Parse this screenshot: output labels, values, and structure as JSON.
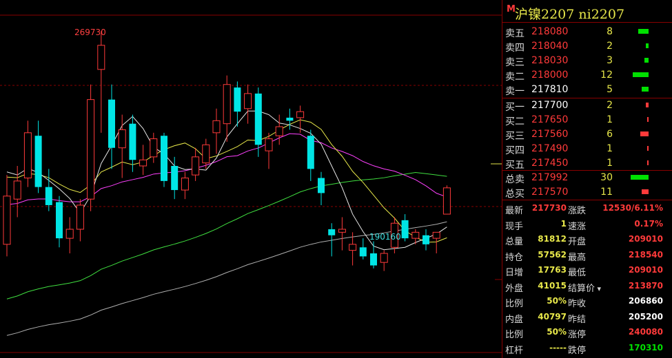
{
  "colors": {
    "up": "#ff3a3a",
    "down": "#00e5e5",
    "ma5": "#e8e8e8",
    "ma10": "#e8e84a",
    "ma20": "#ff40ff",
    "ma40": "#40e040",
    "ma60": "#b0b0b0",
    "yellow": "#e8e84a",
    "green": "#00e000",
    "white": "#ffffff"
  },
  "header": {
    "marker": "M",
    "title": "沪镍2207  ni2207"
  },
  "chart_data": {
    "type": "candlestick",
    "high_label": "269730",
    "low_label": "190160",
    "candles": [
      {
        "o": 199000,
        "h": 222000,
        "l": 195000,
        "c": 215000
      },
      {
        "o": 214000,
        "h": 225000,
        "l": 208000,
        "c": 220000
      },
      {
        "o": 221000,
        "h": 240000,
        "l": 218000,
        "c": 236000
      },
      {
        "o": 235000,
        "h": 240000,
        "l": 216000,
        "c": 218000
      },
      {
        "o": 218000,
        "h": 224000,
        "l": 210000,
        "c": 212000
      },
      {
        "o": 213000,
        "h": 215000,
        "l": 198000,
        "c": 201000
      },
      {
        "o": 201000,
        "h": 208000,
        "l": 196000,
        "c": 204000
      },
      {
        "o": 204000,
        "h": 214000,
        "l": 200000,
        "c": 212000
      },
      {
        "o": 214000,
        "h": 252000,
        "l": 210000,
        "c": 247000
      },
      {
        "o": 257000,
        "h": 269730,
        "l": 236000,
        "c": 265000
      },
      {
        "o": 247000,
        "h": 252000,
        "l": 224000,
        "c": 231000
      },
      {
        "o": 231000,
        "h": 242000,
        "l": 221000,
        "c": 237000
      },
      {
        "o": 239000,
        "h": 242000,
        "l": 223000,
        "c": 227000
      },
      {
        "o": 225000,
        "h": 232000,
        "l": 222000,
        "c": 227000
      },
      {
        "o": 228000,
        "h": 236000,
        "l": 226000,
        "c": 234000
      },
      {
        "o": 235000,
        "h": 236000,
        "l": 218000,
        "c": 220000
      },
      {
        "o": 225000,
        "h": 228000,
        "l": 214000,
        "c": 217000
      },
      {
        "o": 217000,
        "h": 223000,
        "l": 214000,
        "c": 221000
      },
      {
        "o": 222000,
        "h": 231000,
        "l": 220000,
        "c": 228000
      },
      {
        "o": 226000,
        "h": 234000,
        "l": 224000,
        "c": 232000
      },
      {
        "o": 236000,
        "h": 244000,
        "l": 229000,
        "c": 240000
      },
      {
        "o": 239000,
        "h": 255000,
        "l": 233000,
        "c": 252000
      },
      {
        "o": 251000,
        "h": 253000,
        "l": 238000,
        "c": 243000
      },
      {
        "o": 244000,
        "h": 252000,
        "l": 239000,
        "c": 249000
      },
      {
        "o": 249000,
        "h": 251000,
        "l": 228000,
        "c": 232000
      },
      {
        "o": 230000,
        "h": 236000,
        "l": 224000,
        "c": 234000
      },
      {
        "o": 235000,
        "h": 242000,
        "l": 232000,
        "c": 238000
      },
      {
        "o": 241000,
        "h": 244000,
        "l": 237000,
        "c": 240000
      },
      {
        "o": 241000,
        "h": 245000,
        "l": 236000,
        "c": 243000
      },
      {
        "o": 235000,
        "h": 237000,
        "l": 220000,
        "c": 224000
      },
      {
        "o": 221000,
        "h": 223000,
        "l": 212000,
        "c": 216000
      },
      {
        "o": 204000,
        "h": 206000,
        "l": 195000,
        "c": 202000
      },
      {
        "o": 203000,
        "h": 208000,
        "l": 197000,
        "c": 204000
      },
      {
        "o": 197000,
        "h": 203000,
        "l": 192000,
        "c": 199000
      },
      {
        "o": 198000,
        "h": 201000,
        "l": 194000,
        "c": 195000
      },
      {
        "o": 196000,
        "h": 200000,
        "l": 191000,
        "c": 192000
      },
      {
        "o": 193000,
        "h": 197000,
        "l": 190160,
        "c": 196000
      },
      {
        "o": 198000,
        "h": 208000,
        "l": 196000,
        "c": 206000
      },
      {
        "o": 207000,
        "h": 209000,
        "l": 200000,
        "c": 201000
      },
      {
        "o": 201000,
        "h": 204000,
        "l": 199000,
        "c": 203000
      },
      {
        "o": 202000,
        "h": 204000,
        "l": 197000,
        "c": 199000
      },
      {
        "o": 201000,
        "h": 203000,
        "l": 196000,
        "c": 203000
      },
      {
        "o": 209010,
        "h": 218540,
        "l": 209010,
        "c": 217730
      }
    ]
  },
  "orderbook": {
    "sells": [
      {
        "label": "卖五",
        "price": "218080",
        "qty": "8",
        "bar": 0.55
      },
      {
        "label": "卖四",
        "price": "218040",
        "qty": "2",
        "bar": 0.14
      },
      {
        "label": "卖三",
        "price": "218030",
        "qty": "3",
        "bar": 0.2
      },
      {
        "label": "卖二",
        "price": "218000",
        "qty": "12",
        "bar": 0.83
      },
      {
        "label": "卖一",
        "price": "217810",
        "qty": "5",
        "bar": 0.35
      }
    ],
    "buys": [
      {
        "label": "买一",
        "price": "217700",
        "qty": "2",
        "bar": 0.14
      },
      {
        "label": "买二",
        "price": "217650",
        "qty": "1",
        "bar": 0.07
      },
      {
        "label": "买三",
        "price": "217560",
        "qty": "6",
        "bar": 0.42
      },
      {
        "label": "买四",
        "price": "217490",
        "qty": "1",
        "bar": 0.07
      },
      {
        "label": "买五",
        "price": "217450",
        "qty": "1",
        "bar": 0.07
      }
    ],
    "totals": [
      {
        "label": "总卖",
        "price": "217992",
        "qty": "30",
        "bar": 0.92,
        "color": "#00e000"
      },
      {
        "label": "总买",
        "price": "217570",
        "qty": "11",
        "bar": 0.34,
        "color": "#ff3a3a"
      }
    ]
  },
  "stats": [
    {
      "l": "最新",
      "v": "217730",
      "vc": "#ff3a3a",
      "l2": "涨跌",
      "v2": "12530/6.11%",
      "v2c": "#ff3a3a"
    },
    {
      "l": "现手",
      "v": "1",
      "vc": "#e8e84a",
      "l2": "速涨",
      "v2": "0.17%",
      "v2c": "#ff3a3a"
    },
    {
      "l": "总量",
      "v": "81812",
      "vc": "#e8e84a",
      "l2": "开盘",
      "v2": "209010",
      "v2c": "#ff3a3a"
    },
    {
      "l": "持仓",
      "v": "57562",
      "vc": "#e8e84a",
      "l2": "最高",
      "v2": "218540",
      "v2c": "#ff3a3a"
    },
    {
      "l": "日增",
      "v": "17763",
      "vc": "#e8e84a",
      "l2": "最低",
      "v2": "209010",
      "v2c": "#ff3a3a"
    },
    {
      "l": "外盘",
      "v": "41015",
      "vc": "#e8e84a",
      "l2": "结算价",
      "v2": "213870",
      "v2c": "#ff3a3a"
    },
    {
      "l": "比例",
      "v": "50%",
      "vc": "#e8e84a",
      "l2": "昨收",
      "v2": "206860",
      "v2c": "#ffffff"
    },
    {
      "l": "内盘",
      "v": "40797",
      "vc": "#e8e84a",
      "l2": "昨结",
      "v2": "205200",
      "v2c": "#ffffff"
    },
    {
      "l": "比例",
      "v": "50%",
      "vc": "#e8e84a",
      "l2": "涨停",
      "v2": "240080",
      "v2c": "#ff3a3a"
    },
    {
      "l": "杠杆",
      "v": "-----",
      "vc": "#e8e84a",
      "l2": "跌停",
      "v2": "170310",
      "v2c": "#00e000"
    }
  ]
}
